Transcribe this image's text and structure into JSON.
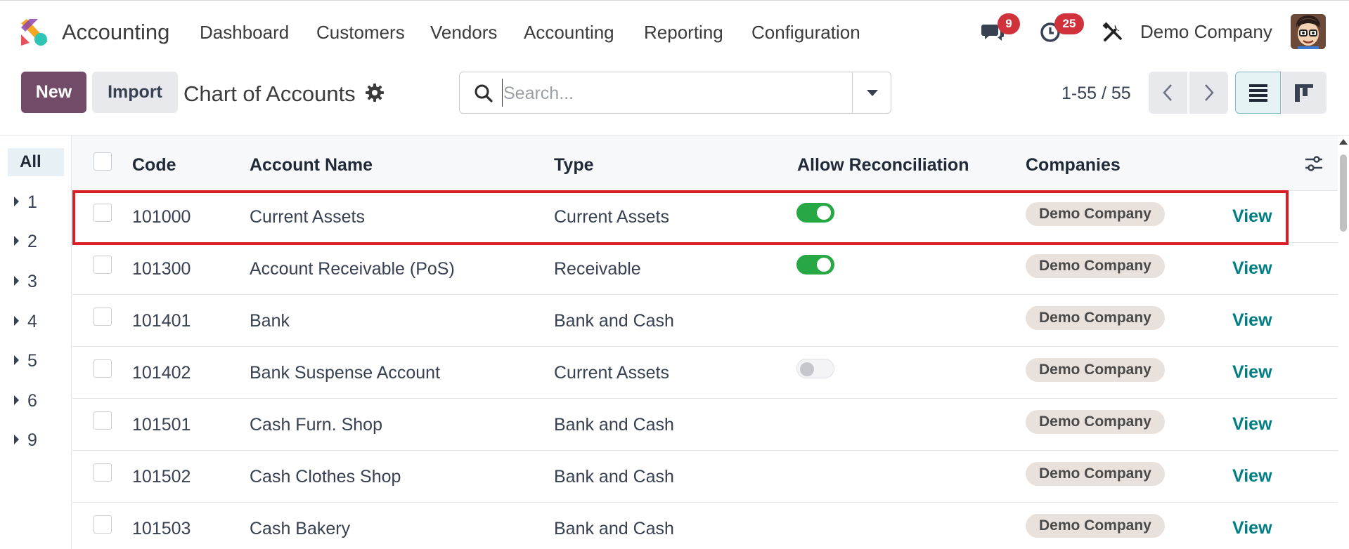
{
  "navbar": {
    "app_name": "Accounting",
    "menu": [
      "Dashboard",
      "Customers",
      "Vendors",
      "Accounting",
      "Reporting",
      "Configuration"
    ],
    "messages_count": "9",
    "activities_count": "25",
    "company": "Demo Company",
    "icons": [
      "app-logo",
      "chat-icon",
      "clock-icon",
      "tools-icon",
      "avatar"
    ]
  },
  "control_panel": {
    "new_label": "New",
    "import_label": "Import",
    "title": "Chart of Accounts",
    "search_placeholder": "Search...",
    "pager_value": "1-55 / 55"
  },
  "side_panel": {
    "items": [
      "All",
      "1",
      "2",
      "3",
      "4",
      "5",
      "6",
      "9"
    ]
  },
  "list": {
    "columns": [
      "Code",
      "Account Name",
      "Type",
      "Allow Reconciliation",
      "Companies"
    ],
    "view_label": "View",
    "rows": [
      {
        "code": "101000",
        "name": "Current Assets",
        "type": "Current Assets",
        "reconcile": "on",
        "company": "Demo Company"
      },
      {
        "code": "101300",
        "name": "Account Receivable (PoS)",
        "type": "Receivable",
        "reconcile": "on",
        "company": "Demo Company"
      },
      {
        "code": "101401",
        "name": "Bank",
        "type": "Bank and Cash",
        "reconcile": "none",
        "company": "Demo Company"
      },
      {
        "code": "101402",
        "name": "Bank Suspense Account",
        "type": "Current Assets",
        "reconcile": "off",
        "company": "Demo Company"
      },
      {
        "code": "101501",
        "name": "Cash Furn. Shop",
        "type": "Bank and Cash",
        "reconcile": "none",
        "company": "Demo Company"
      },
      {
        "code": "101502",
        "name": "Cash Clothes Shop",
        "type": "Bank and Cash",
        "reconcile": "none",
        "company": "Demo Company"
      },
      {
        "code": "101503",
        "name": "Cash Bakery",
        "type": "Bank and Cash",
        "reconcile": "none",
        "company": "Demo Company"
      }
    ]
  },
  "colors": {
    "brand": "#714b67",
    "link": "#017e84",
    "toggle_on": "#28a745",
    "highlight": "#d81f26",
    "badge": "#d0323c"
  }
}
